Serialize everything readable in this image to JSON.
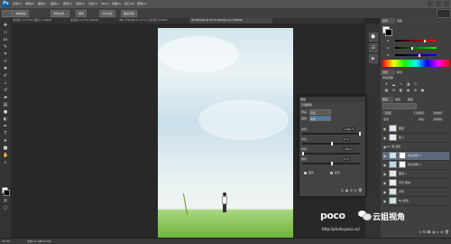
{
  "app": {
    "name": "Ps"
  },
  "menu": [
    "文件(F)",
    "编辑(E)",
    "图像(I)",
    "图层(L)",
    "类型(Y)",
    "选择(S)",
    "滤镜(T)",
    "3D(D)",
    "视图(V)",
    "窗口(W)",
    "帮助(H)"
  ],
  "options_bar": {
    "buttons": [
      "消除锯齿",
      "调整边缘...",
      "细选",
      "目标选区",
      "图层蒙版"
    ]
  },
  "tabs": [
    {
      "label": "未标题-1 @ 12.5% (图层 0, RGB/8)"
    },
    {
      "label": "未标题-2 @ 25% (RGB/8)"
    },
    {
      "label": "IMG_3726.JPG @ 16.7% (云朵背景, RGB/8)"
    },
    {
      "label": "4D MkIII.psd @ 16.7% (Background, RGB/8)"
    }
  ],
  "tool_icons": [
    "move-icon",
    "marquee-icon",
    "lasso-icon",
    "quick-select-icon",
    "crop-icon",
    "eyedropper-icon",
    "healing-icon",
    "brush-icon",
    "stamp-icon",
    "history-brush-icon",
    "eraser-icon",
    "gradient-icon",
    "blur-icon",
    "dodge-icon",
    "pen-icon",
    "type-icon",
    "path-select-icon",
    "shape-icon",
    "hand-icon",
    "zoom-icon"
  ],
  "color_panel": {
    "tab": "颜色",
    "tab2": "色板",
    "channels": [
      {
        "label": "R",
        "value": 0.72
      },
      {
        "label": "G",
        "value": 0.4
      },
      {
        "label": "B",
        "value": 0.6
      }
    ]
  },
  "adjust_panel": {
    "tab": "调整",
    "tab2": "样式",
    "title": "添加调整"
  },
  "layers_panel": {
    "tabs": [
      "图层",
      "通道",
      "路径"
    ],
    "mode": "正常",
    "opacity_label": "不透明度:",
    "opacity": "100%",
    "lock_label": "锁定:",
    "fill_label": "填充:",
    "fill": "100%",
    "layers": [
      {
        "name": "图层",
        "selected": false
      },
      {
        "name": "组 1",
        "selected": false
      },
      {
        "name": "纯色",
        "selected": false
      },
      {
        "name": "组 选区",
        "selected": false
      },
      {
        "name": "色彩调整 1",
        "selected": true
      },
      {
        "name": "色彩调整 2",
        "selected": false
      },
      {
        "name": "图层 1",
        "selected": false
      },
      {
        "name": "背景 副本",
        "selected": false
      },
      {
        "name": "背景",
        "selected": false
      },
      {
        "name": "Bg 颜色",
        "selected": false
      }
    ]
  },
  "properties_panel": {
    "title": "属性",
    "subtitle": "可选颜色",
    "preset_label": "预设:",
    "preset_value": "自定",
    "colors_label": "颜色:",
    "colors_value": "青色",
    "sliders": [
      {
        "label": "青色:",
        "value": "+100 %",
        "pos": 1.0
      },
      {
        "label": "洋红:",
        "value": "0 %",
        "pos": 0.5
      },
      {
        "label": "黄色:",
        "value": "-100 %",
        "pos": 0.0
      },
      {
        "label": "黑色:",
        "value": "0 %",
        "pos": 0.5
      }
    ],
    "method_relative": "相对",
    "method_absolute": "绝对"
  },
  "status": {
    "zoom": "25.4%",
    "doc": "文档:12.9M/22.5M"
  },
  "watermark": {
    "poco": "poco",
    "url": "http://photo.poco.cn/",
    "cn": "云姐视角"
  }
}
